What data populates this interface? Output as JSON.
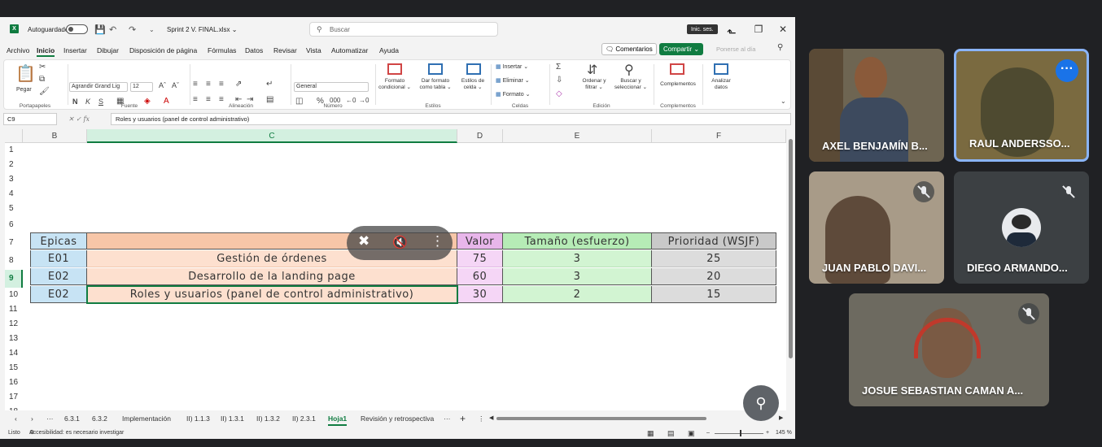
{
  "window": {
    "autosave_label": "Autoguardado",
    "filename": "Sprint 2 V. FINAL.xlsx ⌄",
    "search_placeholder": "Buscar",
    "signin_label": "Inic. ses."
  },
  "menu": {
    "items": [
      "Archivo",
      "Inicio",
      "Insertar",
      "Dibujar",
      "Disposición de página",
      "Fórmulas",
      "Datos",
      "Revisar",
      "Vista",
      "Automatizar",
      "Ayuda"
    ],
    "active": "Inicio",
    "comments_label": "Comentarios",
    "share_label": "Compartir ⌄",
    "status_label": "Ponerse al día"
  },
  "ribbon": {
    "paste_label": "Pegar",
    "clipboard_group": "Portapapeles",
    "font_name": "Agrandir Grand Lig",
    "font_size": "12",
    "font_group": "Fuente",
    "alignment_group": "Alineación",
    "number_format": "General",
    "number_group": "Número",
    "cond_format_label": "Formato condicional ⌄",
    "table_format_label": "Dar formato como tabla ⌄",
    "cell_styles_label": "Estilos de celda ⌄",
    "styles_group": "Estilos",
    "insert_label": "Insertar",
    "delete_label": "Eliminar",
    "format_label": "Formato",
    "cells_group": "Celdas",
    "sort_label": "Ordenar y filtrar ⌄",
    "find_label": "Buscar y seleccionar ⌄",
    "editing_group": "Edición",
    "addins_label": "Complementos",
    "addins_group": "Complementos",
    "analyze_label": "Analizar datos"
  },
  "formula_bar": {
    "name_box": "C9",
    "content": "Roles y usuarios (panel de control administrativo)"
  },
  "columns": [
    "B",
    "C",
    "D",
    "E",
    "F"
  ],
  "rows": [
    "1",
    "2",
    "3",
    "4",
    "5",
    "6",
    "7",
    "8",
    "9",
    "10",
    "11",
    "12",
    "13",
    "14",
    "15",
    "16",
    "17",
    "18"
  ],
  "table": {
    "headers": [
      "Epicas",
      "",
      "Valor",
      "Tamaño (esfuerzo)",
      "Prioridad (WSJF)"
    ],
    "rows": [
      [
        "E01",
        "Gestión de órdenes",
        "75",
        "3",
        "25"
      ],
      [
        "E02",
        "Desarrollo de la landing page",
        "60",
        "3",
        "20"
      ],
      [
        "E02",
        "Roles y usuarios (panel de control administrativo)",
        "30",
        "2",
        "15"
      ]
    ]
  },
  "sheet_tabs": [
    "6.3.1",
    "6.3.2",
    "Implementación",
    "II) 1.1.3",
    "II) 1.3.1",
    "II) 1.3.2",
    "II) 2.3.1",
    "Hoja1",
    "Revisión y retrospectiva"
  ],
  "active_sheet": "Hoja1",
  "status": {
    "ready": "Listo",
    "accessibility": "Accesibilidad: es necesario investigar",
    "zoom": "145 %"
  },
  "participants": [
    {
      "name": "AXEL BENJAMÍN B...",
      "muted": false
    },
    {
      "name": "RAUL ANDERSSO...",
      "muted": false,
      "active_speaker": true
    },
    {
      "name": "JUAN PABLO DAVI...",
      "muted": true
    },
    {
      "name": "DIEGO ARMANDO...",
      "muted": true
    },
    {
      "name": "JOSUE SEBASTIAN CAMAN A...",
      "muted": true
    }
  ],
  "colors": {
    "excel_green": "#107c41",
    "epicas_fill": "#c7e3f4",
    "title_fill": "#f7c6a8",
    "valor_fill": "#e8b6ea",
    "tamano_fill": "#b6ecb6",
    "prioridad_fill": "#c9c9c9",
    "meet_accent": "#1a73e8"
  }
}
